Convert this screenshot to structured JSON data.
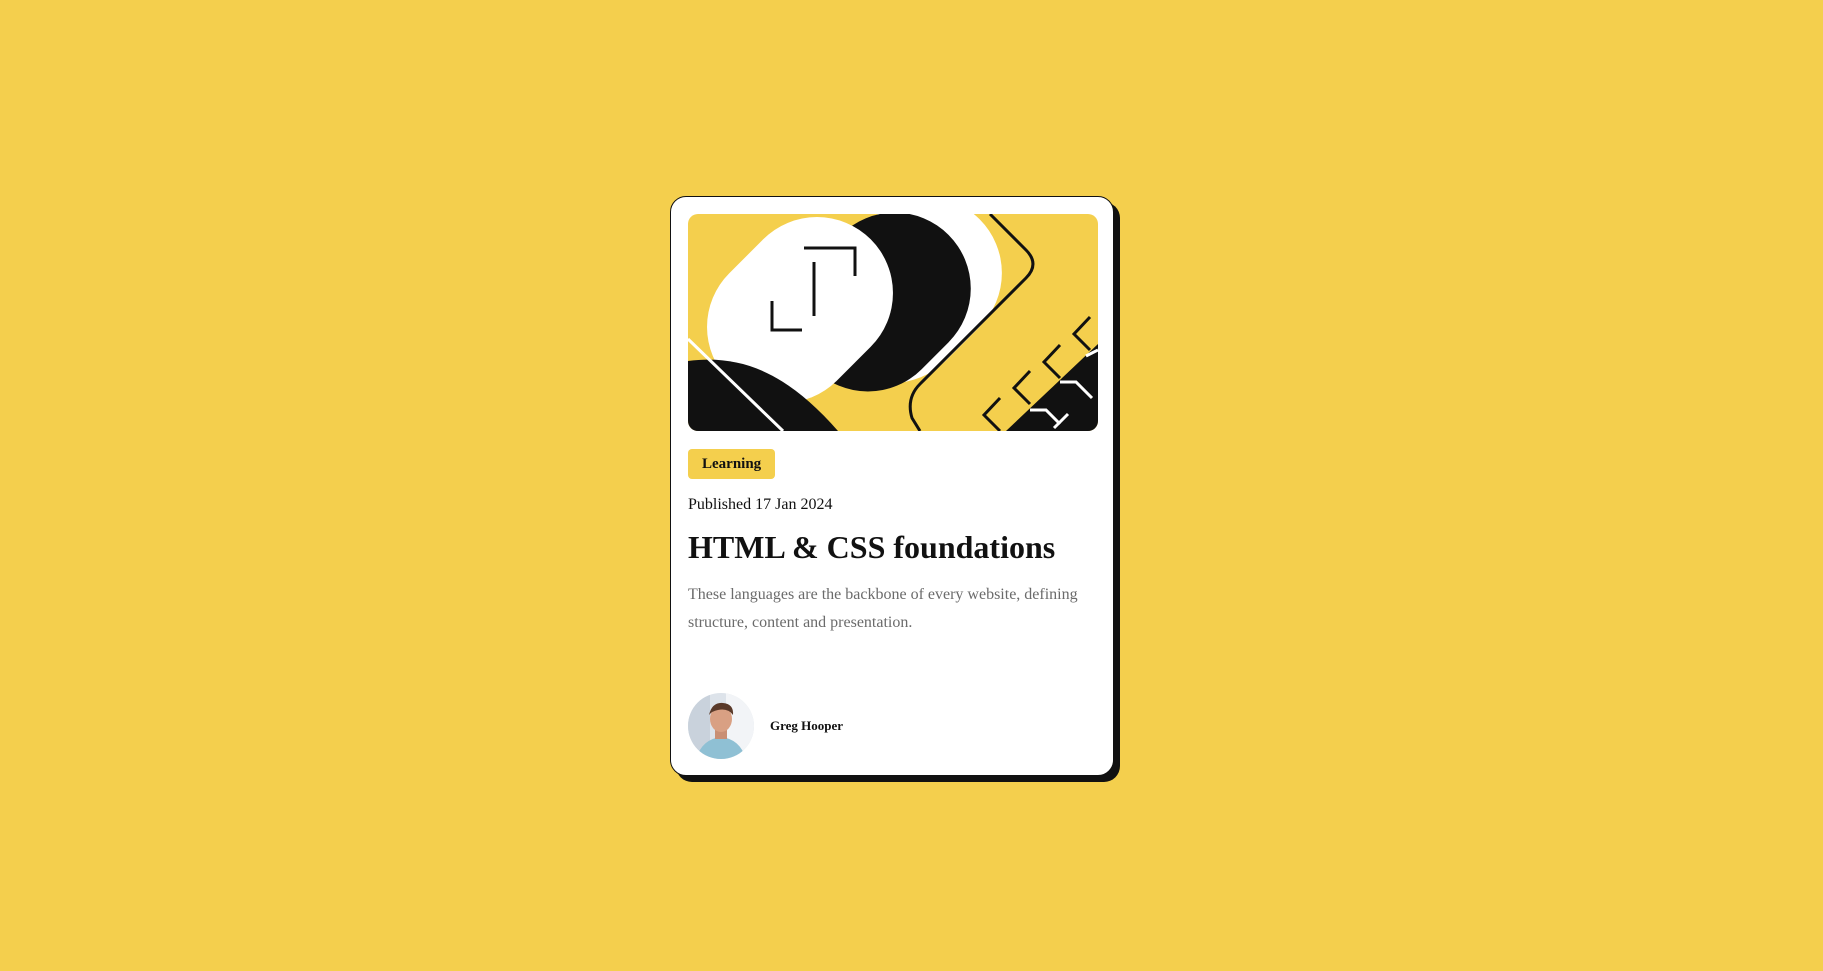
{
  "card": {
    "category_tag": "Learning",
    "published": "Published 17 Jan 2024",
    "title": "HTML & CSS foundations",
    "description": "These languages are the backbone of every website, defining structure, content and presentation.",
    "author": {
      "name": "Greg Hooper"
    }
  },
  "colors": {
    "background": "#F4CF4D",
    "card": "#FFFFFF",
    "ink": "#111111",
    "muted_text": "#6B6B6B"
  },
  "icons": {
    "hero": "abstract-illustration",
    "avatar": "author-photo"
  }
}
